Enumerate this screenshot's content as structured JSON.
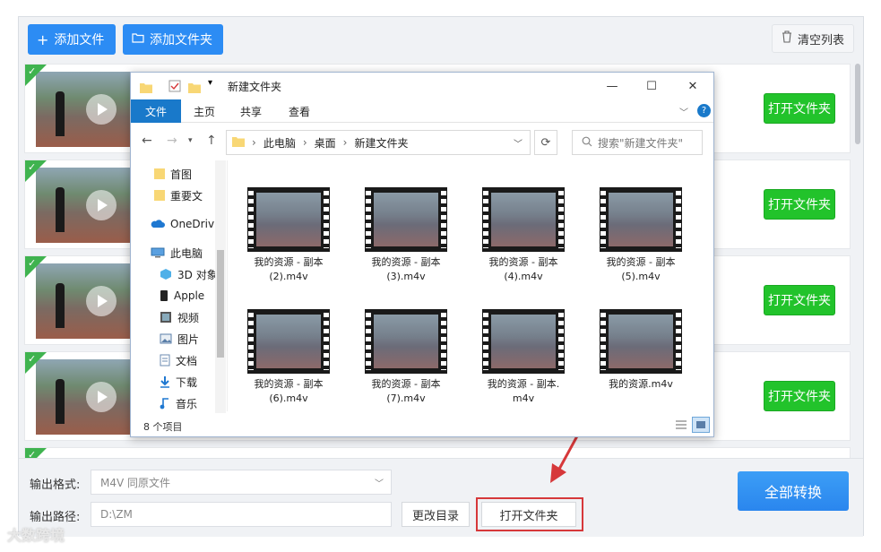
{
  "toolbar": {
    "add_file": "添加文件",
    "add_folder": "添加文件夹",
    "clear_list": "清空列表"
  },
  "rows": [
    {
      "open_label": "打开文件夹"
    },
    {
      "open_label": "打开文件夹"
    },
    {
      "open_label": "打开文件夹"
    },
    {
      "open_label": "打开文件夹"
    }
  ],
  "bottom": {
    "format_label": "输出格式:",
    "format_value": "M4V   同原文件",
    "path_label": "输出路径:",
    "path_value": "D:\\ZM",
    "change_dir": "更改目录",
    "open_folder": "打开文件夹",
    "convert_all": "全部转换"
  },
  "explorer": {
    "title": "新建文件夹",
    "tabs": [
      "文件",
      "主页",
      "共享",
      "查看"
    ],
    "breadcrumb": [
      "此电脑",
      "桌面",
      "新建文件夹"
    ],
    "search_placeholder": "搜索\"新建文件夹\"",
    "nav": [
      "首图",
      "重要文",
      "OneDriv",
      "此电脑",
      "3D 对象",
      "Apple",
      "视频",
      "图片",
      "文档",
      "下载",
      "音乐"
    ],
    "files": [
      {
        "name1": "我的资源 - 副本",
        "name2": "(2).m4v"
      },
      {
        "name1": "我的资源 - 副本",
        "name2": "(3).m4v"
      },
      {
        "name1": "我的资源 - 副本",
        "name2": "(4).m4v"
      },
      {
        "name1": "我的资源 - 副本",
        "name2": "(5).m4v"
      },
      {
        "name1": "我的资源 - 副本",
        "name2": "(6).m4v"
      },
      {
        "name1": "我的资源 - 副本",
        "name2": "(7).m4v"
      },
      {
        "name1": "我的资源 - 副本.",
        "name2": "m4v"
      },
      {
        "name1": "我的资源.m4v",
        "name2": ""
      }
    ],
    "item_count": "8 个项目"
  },
  "watermark": "大数跨境",
  "colors": {
    "primary_blue": "#2c8cf4",
    "open_green": "#22c32b",
    "highlight_red": "#d6383a",
    "ribbon_blue": "#1979ca"
  }
}
